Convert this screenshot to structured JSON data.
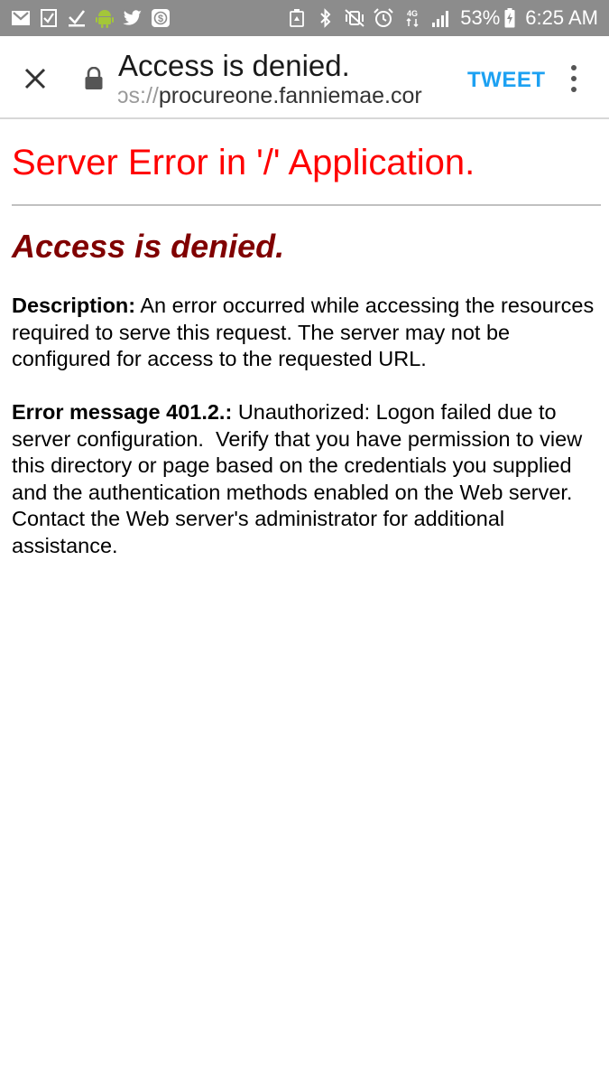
{
  "status_bar": {
    "left_icons": [
      "gmail-icon",
      "checkbox-task-icon",
      "checkmark-icon",
      "android-icon",
      "twitter-icon",
      "dollar-app-icon"
    ],
    "right_icons": [
      "recycle-icon",
      "bluetooth-icon",
      "vibrate-mute-icon",
      "alarm-icon",
      "data-4g-icon",
      "signal-icon",
      "battery-charging-icon"
    ],
    "battery": "53%",
    "time": "6:25 AM"
  },
  "toolbar": {
    "title": "Access is denied.",
    "url_scheme_partial": "ɔs://",
    "url_host": "procureone.fanniemae.cor",
    "tweet_label": "TWEET"
  },
  "page": {
    "heading": "Server Error in '/' Application.",
    "subheading": "Access is denied.",
    "description_label": "Description:",
    "description_text": " An error occurred while accessing the resources required to serve this request. The server may not be configured for access to the requested URL.",
    "error_label": "Error message 401.2.:",
    "error_text": " Unauthorized: Logon failed due to server configuration.  Verify that you have permission to view this directory or page based on the credentials you supplied and the authentication methods enabled on the Web server.  Contact the Web server's administrator for additional assistance."
  },
  "colors": {
    "status_bar_bg": "#8c8c8c",
    "heading_red": "#ff0000",
    "subheading_maroon": "#800000",
    "tweet_blue": "#1da1f2"
  }
}
